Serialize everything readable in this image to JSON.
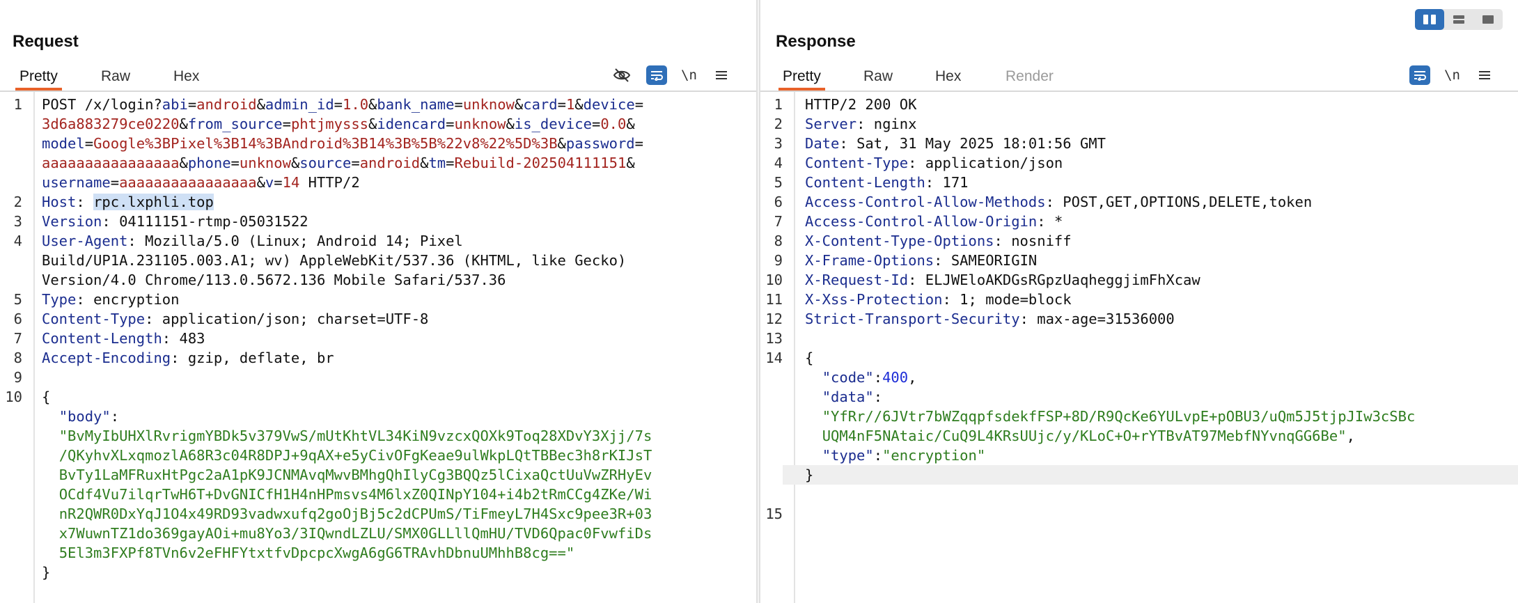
{
  "layout_toggles": [
    {
      "icon": "split-columns-icon",
      "active": true
    },
    {
      "icon": "split-rows-icon",
      "active": false
    },
    {
      "icon": "single-pane-icon",
      "active": false
    }
  ],
  "request": {
    "title": "Request",
    "tabs": [
      "Pretty",
      "Raw",
      "Hex"
    ],
    "active_tab": "Pretty",
    "toolbar": {
      "hide_icon": "eye-off-icon",
      "wrap_icon": "word-wrap-icon",
      "newline_label": "\\n",
      "menu_icon": "menu-icon"
    },
    "line_numbers": [
      "1",
      "",
      "",
      "",
      "",
      "2",
      "3",
      "4",
      "",
      "",
      "5",
      "6",
      "7",
      "8",
      "9",
      "10",
      "",
      "",
      "",
      "",
      "",
      "",
      "",
      "",
      "",
      ""
    ],
    "request_line": {
      "method_path": "POST /x/login?",
      "params": [
        {
          "k": "abi",
          "v": "android"
        },
        {
          "k": "admin_id",
          "v": "1.0"
        },
        {
          "k": "bank_name",
          "v": "unknow"
        },
        {
          "k": "card",
          "v": "1"
        },
        {
          "k": "device",
          "v": "3d6a883279ce0220"
        },
        {
          "k": "from_source",
          "v": "phtjmysss"
        },
        {
          "k": "idencard",
          "v": "unknow"
        },
        {
          "k": "is_device",
          "v": "0.0"
        },
        {
          "k": "model",
          "v": "Google%3BPixel%3B14%3BAndroid%3B14%3B%5B%22v8%22%5D%3B"
        },
        {
          "k": "password",
          "v": "aaaaaaaaaaaaaaaa"
        },
        {
          "k": "phone",
          "v": "unknow"
        },
        {
          "k": "source",
          "v": "android"
        },
        {
          "k": "tm",
          "v": "Rebuild-202504111151"
        },
        {
          "k": "username",
          "v": "aaaaaaaaaaaaaaaa"
        },
        {
          "k": "v",
          "v": "14"
        }
      ],
      "protocol": " HTTP/2"
    },
    "headers": [
      {
        "k": "Host",
        "v": "rpc.lxphli.top"
      },
      {
        "k": "Version",
        "v": "04111151-rtmp-05031522"
      },
      {
        "k": "User-Agent",
        "v": "Mozilla/5.0 (Linux; Android 14; Pixel Build/UP1A.231105.003.A1; wv) AppleWebKit/537.36 (KHTML, like Gecko) Version/4.0 Chrome/113.0.5672.136 Mobile Safari/537.36"
      },
      {
        "k": "Type",
        "v": "encryption"
      },
      {
        "k": "Content-Type",
        "v": "application/json; charset=UTF-8"
      },
      {
        "k": "Content-Length",
        "v": "483"
      },
      {
        "k": "Accept-Encoding",
        "v": "gzip, deflate, br"
      }
    ],
    "body": {
      "open": "{",
      "key": "\"body\"",
      "value_lines": [
        "\"BvMyIbUHXlRvrigmYBDk5v379VwS/mUtKhtVL34KiN9vzcxQOXk9Toq28XDvY3Xjj/7s",
        "/QKyhvXLxqmozlA68R3c04R8DPJ+9qAX+e5yCivOFgKeae9ulWkpLQtTBBec3h8rKIJsT",
        "BvTy1LaMFRuxHtPgc2aA1pK9JCNMAvqMwvBMhgQhIlyCg3BQQz5lCixaQctUuVwZRHyEv",
        "OCdf4Vu7ilqrTwH6T+DvGNICfH1H4nHPmsvs4M6lxZ0QINpY104+i4b2tRmCCg4ZKe/Wi",
        "nR2QWR0DxYqJ1O4x49RD93vadwxufq2goOjBj5c2dCPUmS/TiFmeyL7H4Sxc9pee3R+03",
        "x7WuwnTZ1do369gayAOi+mu8Yo3/3IQwndLZLU/SMX0GLLllQmHU/TVD6Qpac0FvwfiDs",
        "5El3m3FXPf8TVn6v2eFHFYtxtfvDpcpcXwgA6gG6TRAvhDbnuUMhhB8cg==\""
      ],
      "close": "}"
    }
  },
  "response": {
    "title": "Response",
    "tabs": [
      "Pretty",
      "Raw",
      "Hex",
      "Render"
    ],
    "active_tab": "Pretty",
    "toolbar": {
      "wrap_icon": "word-wrap-icon",
      "newline_label": "\\n",
      "menu_icon": "menu-icon"
    },
    "status_line": "HTTP/2 200 OK",
    "headers": [
      {
        "k": "Server",
        "v": "nginx"
      },
      {
        "k": "Date",
        "v": "Sat, 31 May 2025 18:01:56 GMT"
      },
      {
        "k": "Content-Type",
        "v": "application/json"
      },
      {
        "k": "Content-Length",
        "v": "171"
      },
      {
        "k": "Access-Control-Allow-Methods",
        "v": "POST,GET,OPTIONS,DELETE,token"
      },
      {
        "k": "Access-Control-Allow-Origin",
        "v": "*"
      },
      {
        "k": "X-Content-Type-Options",
        "v": "nosniff"
      },
      {
        "k": "X-Frame-Options",
        "v": "SAMEORIGIN"
      },
      {
        "k": "X-Request-Id",
        "v": "ELJWEloAKDGsRGpzUaqheggjimFhXcaw"
      },
      {
        "k": "X-Xss-Protection",
        "v": "1; mode=block"
      },
      {
        "k": "Strict-Transport-Security",
        "v": "max-age=31536000"
      }
    ],
    "line_numbers": [
      "1",
      "2",
      "3",
      "4",
      "5",
      "6",
      "7",
      "8",
      "9",
      "10",
      "11",
      "12",
      "13",
      "14",
      "",
      "",
      "",
      "",
      "",
      "",
      "15"
    ],
    "body": {
      "open": "{",
      "code_key": "\"code\"",
      "code_value": "400",
      "data_key": "\"data\"",
      "data_value_lines": [
        "\"YfRr//6JVtr7bWZqqpfsdekfFSP+8D/R9QcKe6YULvpE+pOBU3/uQm5J5tjpJIw3cSBc",
        "UQM4nF5NAtaic/CuQ9L4KRsUUjc/y/KLoC+O+rYTBvAT97MebfNYvnqGG6Be\""
      ],
      "type_key": "\"type\"",
      "type_value": "\"encryption\"",
      "close": "}"
    }
  }
}
